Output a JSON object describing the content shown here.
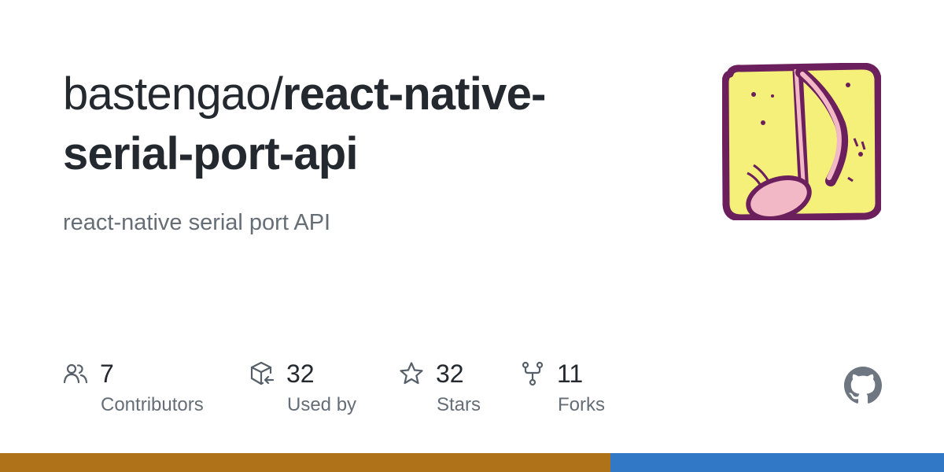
{
  "repo": {
    "owner": "bastengao/",
    "name": "react-native-serial-port-api",
    "description": "react-native serial port API"
  },
  "stats": [
    {
      "icon": "people-icon",
      "value": "7",
      "label": "Contributors"
    },
    {
      "icon": "package-dependents-icon",
      "value": "32",
      "label": "Used by"
    },
    {
      "icon": "star-icon",
      "value": "32",
      "label": "Stars"
    },
    {
      "icon": "repo-forked-icon",
      "value": "11",
      "label": "Forks"
    }
  ],
  "languages": [
    {
      "share": 0.647,
      "color": "#b07219"
    },
    {
      "share": 0.353,
      "color": "#3178c6"
    }
  ],
  "colors": {
    "text_primary": "#24292f",
    "text_secondary": "#656d76",
    "icon": "#57606a",
    "avatar_bg": "#f5f07a",
    "avatar_border": "#6b1f5c",
    "note_fill": "#f2b8c6"
  }
}
